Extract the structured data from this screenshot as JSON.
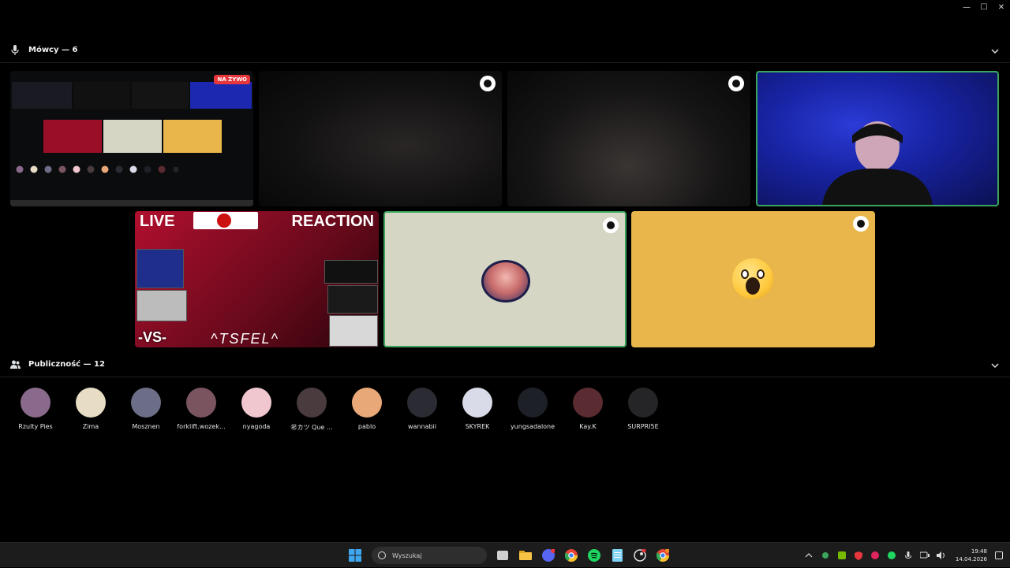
{
  "window": {
    "minimize": "—",
    "maximize": "☐",
    "close": "✕"
  },
  "speakers": {
    "title": "Mówcy — 6"
  },
  "audience": {
    "title": "Publiczność — 12",
    "members": [
      {
        "name": "Rzulty Pies",
        "color": "#8a6a8c"
      },
      {
        "name": "Zima",
        "color": "#e7dcc4"
      },
      {
        "name": "Mosznen",
        "color": "#6b6e86"
      },
      {
        "name": "forklift.wozek...",
        "color": "#7a5560"
      },
      {
        "name": "nyagoda",
        "color": "#f0c7cf"
      },
      {
        "name": "㊗カツ Que ...",
        "color": "#4a3b3f"
      },
      {
        "name": "pablo",
        "color": "#e8a877"
      },
      {
        "name": "wannabii",
        "color": "#2b2b33"
      },
      {
        "name": "SKYREK",
        "color": "#d9dbe9"
      },
      {
        "name": "yungsadalone",
        "color": "#1e2027"
      },
      {
        "name": "Kay.K",
        "color": "#5a2b30"
      },
      {
        "name": "SURPRI5E",
        "color": "#252527"
      }
    ]
  },
  "tiles": {
    "live_badge": "NA ŻYWO",
    "reaction": {
      "live": "LIVE",
      "reaction": "REACTION",
      "vs": "-VS-",
      "name": "^TSFEL^"
    }
  },
  "taskbar": {
    "search_placeholder": "Wyszukaj",
    "time": "19:48",
    "date": "14.04.2026"
  },
  "colors": {
    "speaking_border": "#3ba55d",
    "live_red": "#e7373d"
  }
}
